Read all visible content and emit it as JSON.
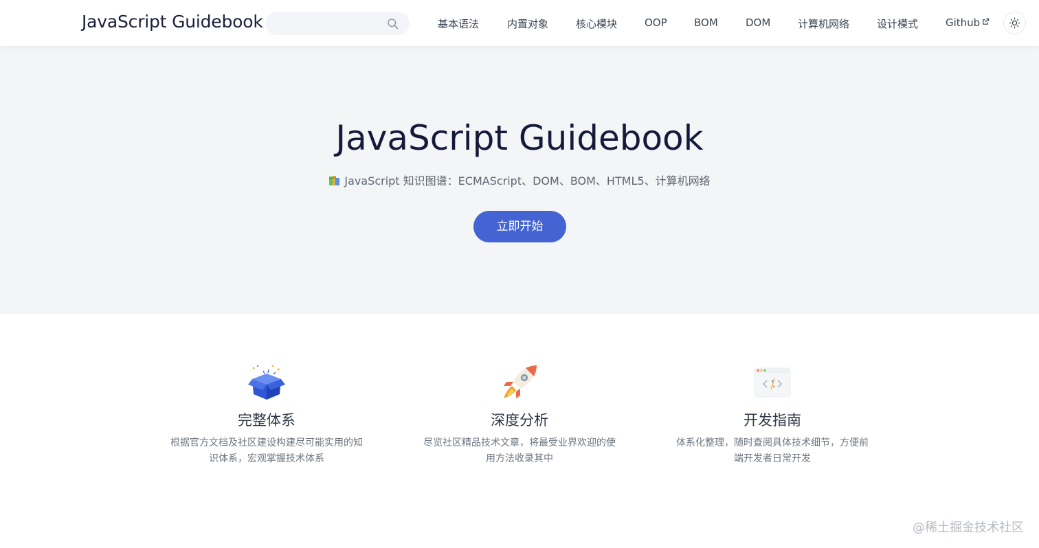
{
  "site": {
    "title": "JavaScript Guidebook"
  },
  "search": {
    "value": "",
    "placeholder": ""
  },
  "nav": {
    "items": [
      {
        "label": "基本语法"
      },
      {
        "label": "内置对象"
      },
      {
        "label": "核心模块"
      },
      {
        "label": "OOP"
      },
      {
        "label": "BOM"
      },
      {
        "label": "DOM"
      },
      {
        "label": "计算机网络"
      },
      {
        "label": "设计模式"
      },
      {
        "label": "Github"
      }
    ]
  },
  "hero": {
    "title": "JavaScript Guidebook",
    "subtitle": "JavaScript 知识图谱：ECMAScript、DOM、BOM、HTML5、计算机网络",
    "cta_label": "立即开始"
  },
  "features": [
    {
      "icon": "gift-box-icon",
      "title": "完整体系",
      "desc": "根据官方文档及社区建设构建尽可能实用的知识体系，宏观掌握技术体系"
    },
    {
      "icon": "rocket-icon",
      "title": "深度分析",
      "desc": "尽览社区精品技术文章，将最受业界欢迎的使用方法收录其中"
    },
    {
      "icon": "code-window-icon",
      "title": "开发指南",
      "desc": "体系化整理，随时查阅具体技术细节，方便前端开发者日常开发"
    }
  ],
  "watermark": "@稀土掘金技术社区",
  "colors": {
    "accent": "#4464d4",
    "hero_bg": "#f3f5f7",
    "title": "#15193a"
  }
}
